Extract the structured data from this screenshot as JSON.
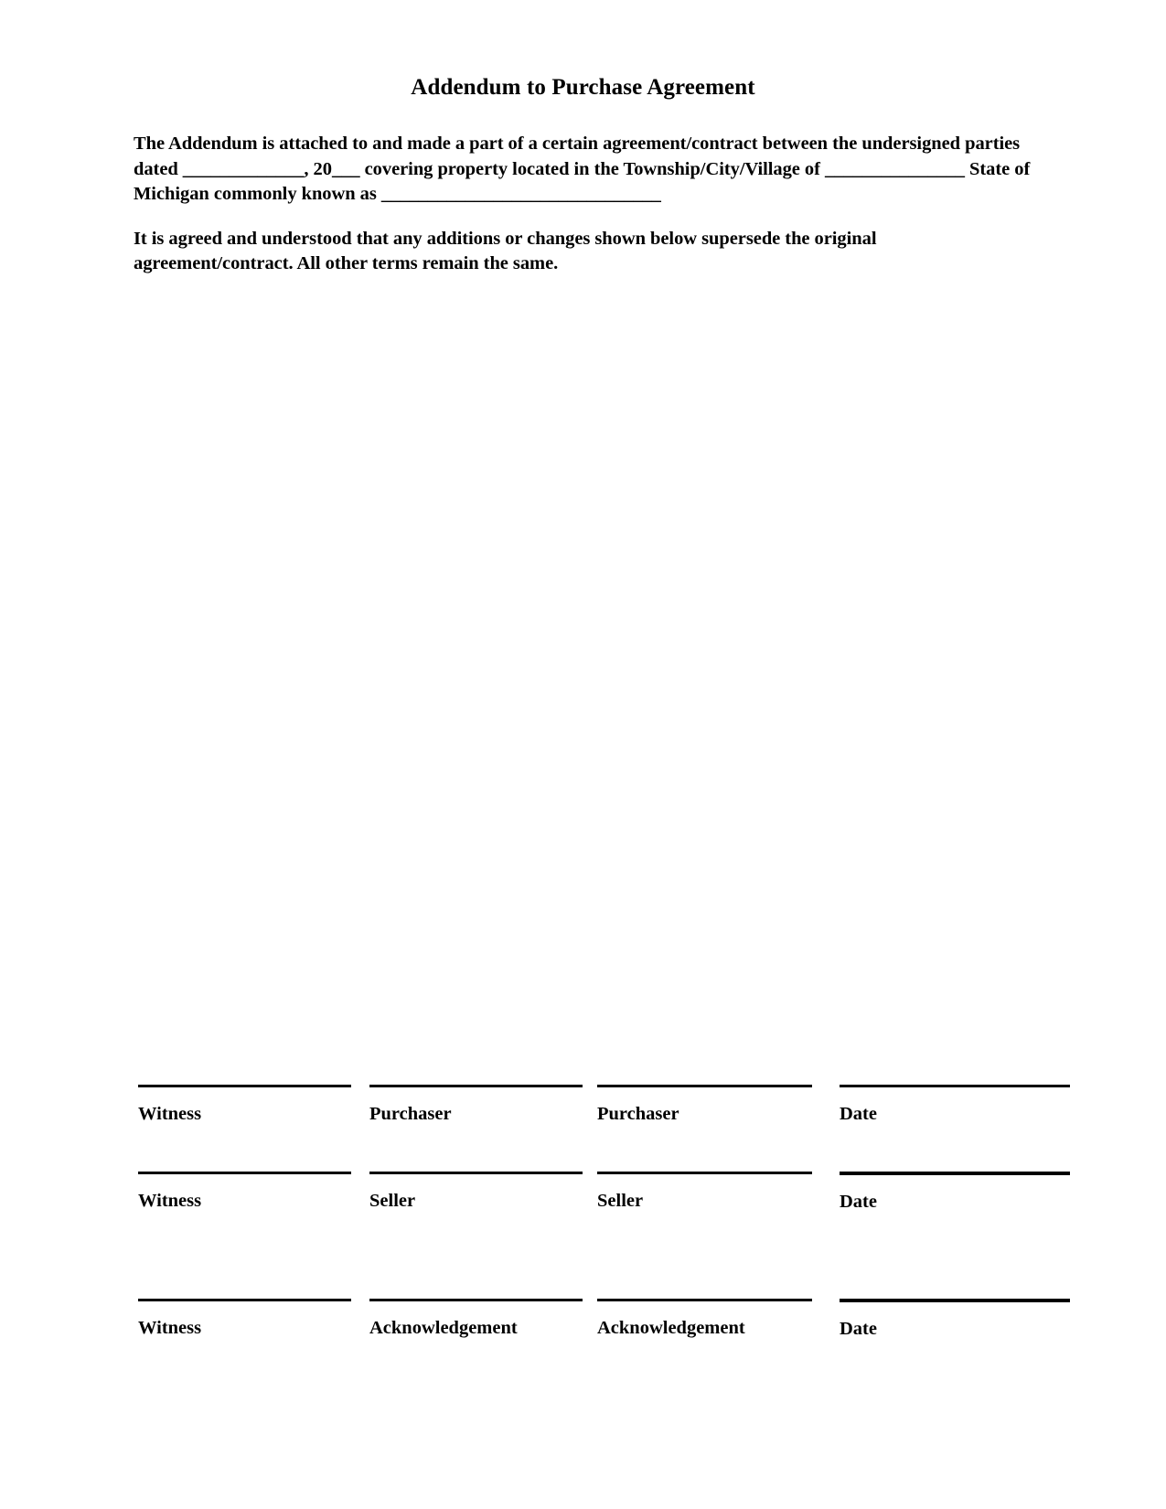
{
  "document": {
    "title": "Addendum to Purchase Agreement",
    "paragraphs": {
      "intro": "The Addendum is attached to and made a part of a certain agreement/contract between the undersigned parties dated _____________, 20___ covering property located in the Township/City/Village of _______________ State of Michigan commonly known as ______________________________",
      "agreement": "It is agreed and understood that any additions or changes shown below supersede the original agreement/contract. All other terms remain the same."
    }
  },
  "signatures": {
    "rows": [
      {
        "cells": [
          {
            "caption": "Witness"
          },
          {
            "caption": "Purchaser"
          },
          {
            "caption": "Purchaser"
          },
          {
            "caption": "Date"
          }
        ]
      },
      {
        "cells": [
          {
            "caption": "Witness"
          },
          {
            "caption": "Seller"
          },
          {
            "caption": "Seller"
          },
          {
            "caption": "Date"
          }
        ]
      },
      {
        "cells": [
          {
            "caption": "Witness"
          },
          {
            "caption": "Acknowledgement"
          },
          {
            "caption": "Acknowledgement"
          },
          {
            "caption": "Date"
          }
        ]
      }
    ]
  },
  "colors": {
    "ink": "#000000",
    "paper": "#ffffff"
  }
}
